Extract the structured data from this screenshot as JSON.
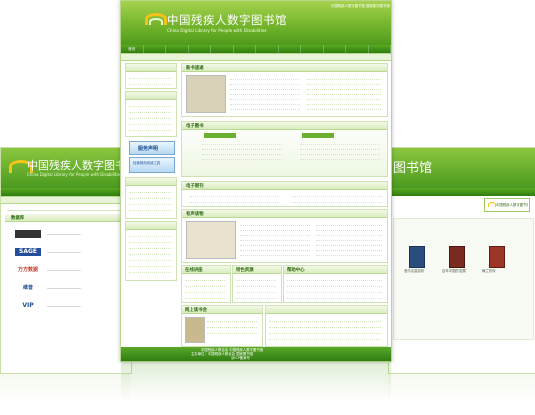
{
  "logo": {
    "title_cn": "中国残疾人数字图书馆",
    "title_en": "China Digital Library for People with Disabilities"
  },
  "header_links": [
    "中国残疾人数字图书馆",
    "国家数字图书馆"
  ],
  "nav": {
    "items": [
      "首页",
      "",
      "",
      "",
      "",
      "",
      "",
      "",
      "",
      "",
      "",
      ""
    ]
  },
  "badge_label": "中国残疾人数字图书馆",
  "panels": {
    "new_arrivals": "新书速递",
    "ebooks": "电子图书",
    "elearning": "电子期刊",
    "audio": "有声读物",
    "lectures": "在线讲座",
    "special": "特色资源",
    "recommend": "网上读书会",
    "help": "帮助中心"
  },
  "left_cards": [
    "服务声明",
    "检索网页阅读工具"
  ],
  "footer": {
    "line1": "中国残疾人联合会  中国残疾人数字图书馆",
    "line2": "主办单位：中国残疾人联合会  国家图书馆",
    "line3": "京ICP备案号"
  },
  "left_window": {
    "title_cn": "中国残疾人数字图书馆",
    "title_en": "China Digital Library for People with Disabilities",
    "sidebar_header": "数据库",
    "logos": [
      "CNKI",
      "SAGE",
      "万方数据",
      "维普",
      "VIP"
    ]
  },
  "right_window": {
    "title_cn": "图书馆",
    "books": [
      "音乐名曲赏析",
      "百年中国的发展",
      "梅兰芳传"
    ]
  }
}
